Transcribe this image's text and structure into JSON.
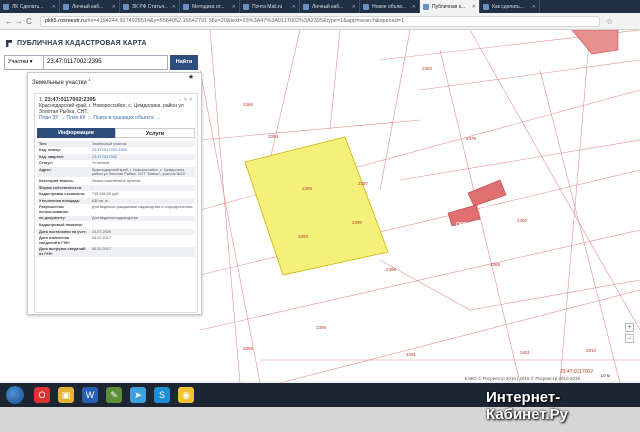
{
  "browser": {
    "tabs": [
      {
        "label": "ЛК Сделать...",
        "active": false
      },
      {
        "label": "Личный каб...",
        "active": false
      },
      {
        "label": "ЗК РФ Статья...",
        "active": false
      },
      {
        "label": "Методика от...",
        "active": false
      },
      {
        "label": "Почта Mail.ru",
        "active": false
      },
      {
        "label": "Личный каб...",
        "active": false
      },
      {
        "label": "Новое объяв...",
        "active": false
      },
      {
        "label": "Публичная к...",
        "active": true
      },
      {
        "label": "Как сделать...",
        "active": false
      }
    ],
    "url_host": "pkk5.rosreestr.ru",
    "url_rest": "/#x=4194244.9274928514&y=5584052.16542791 38z=20&text=23%3A47%3A0117002%3A2395&type=1&app=search&opened=1",
    "nav_back": "←",
    "nav_forward": "→",
    "nav_reload": "C",
    "bookmark_icon": "star-icon"
  },
  "app": {
    "title": "ПУБЛИЧНАЯ КАДАСТРОВАЯ КАРТА",
    "search": {
      "type_value": "Участки",
      "query_value": "23:47:0117002:2395",
      "find_label": "Найти"
    },
    "results_title": "Земельные участки",
    "results_count": "1",
    "card": {
      "index": "1.",
      "number": "23:47:0117002:2395",
      "address": "Краснодарский край, г. Новороссийск, с. Цемдолина, район ул Золотая Рыбка, СНТ.",
      "links": "План ЗУ →  План КК →  Поиск в границах объекта →",
      "tab_info": "Информация",
      "tab_services": "Услуги",
      "rows": [
        {
          "k": "Тип:",
          "v": "Земельный участок",
          "link": false
        },
        {
          "k": "Кад. номер:",
          "v": "23:47:0117002:2395",
          "link": true
        },
        {
          "k": "Кад. квартал:",
          "v": "23:47:0117002",
          "link": true
        },
        {
          "k": "Статус:",
          "v": "Учтенный",
          "link": false
        },
        {
          "k": "Адрес:",
          "v": "Краснодарский край, г. Новороссийск, с. Цемдолина, район ул Золотая Рыбка, СНТ \"Кевсы\", участок №15",
          "link": false
        },
        {
          "k": "Категория земель:",
          "v": "Земли населённых пунктов",
          "link": false
        },
        {
          "k": "Форма собственности:",
          "v": "-",
          "link": false
        },
        {
          "k": "Кадастровая стоимость:",
          "v": "715 345,50 руб.",
          "link": false
        },
        {
          "k": "Уточненная площадь:",
          "v": "630 кв. м",
          "link": false
        },
        {
          "k": "Разрешенное использование:",
          "v": "Для ведения гражданами садоводства и огородничества",
          "link": false
        },
        {
          "k": "по документу:",
          "v": "Для ведения садоводства",
          "link": false
        },
        {
          "k": "Кадастровый инженер:",
          "v": "-",
          "link": false
        },
        {
          "k": "Дата постановки на учет:",
          "v": "24.07.2009",
          "link": false
        },
        {
          "k": "Дата изменения сведений в ГКН:",
          "v": "05.02.2017",
          "link": false
        },
        {
          "k": "Дата выгрузки сведений из ГКН:",
          "v": "05.02.2017",
          "link": false
        }
      ]
    }
  },
  "map": {
    "parcel_labels": [
      "2396",
      "2395",
      "2397",
      "2394",
      "2379",
      "2393",
      "2398",
      "2390",
      "2391",
      "2396",
      "2369",
      "2400",
      "2810",
      "2399",
      "2401",
      "2383"
    ],
    "tags": [
      "ОКС",
      "ОКС"
    ],
    "quarter_label": "23:47:0117002",
    "attribution": "ЕЭКО © Росреестр 2010 | 2016 © Росреестр 2010-2016",
    "scale": "10 м"
  },
  "taskbar": {
    "start": "start",
    "apps": [
      "chrome",
      "opera",
      "explorer",
      "word",
      "paint",
      "telegram",
      "skype"
    ]
  },
  "watermark": "Интернет-Кабинет.Ру"
}
